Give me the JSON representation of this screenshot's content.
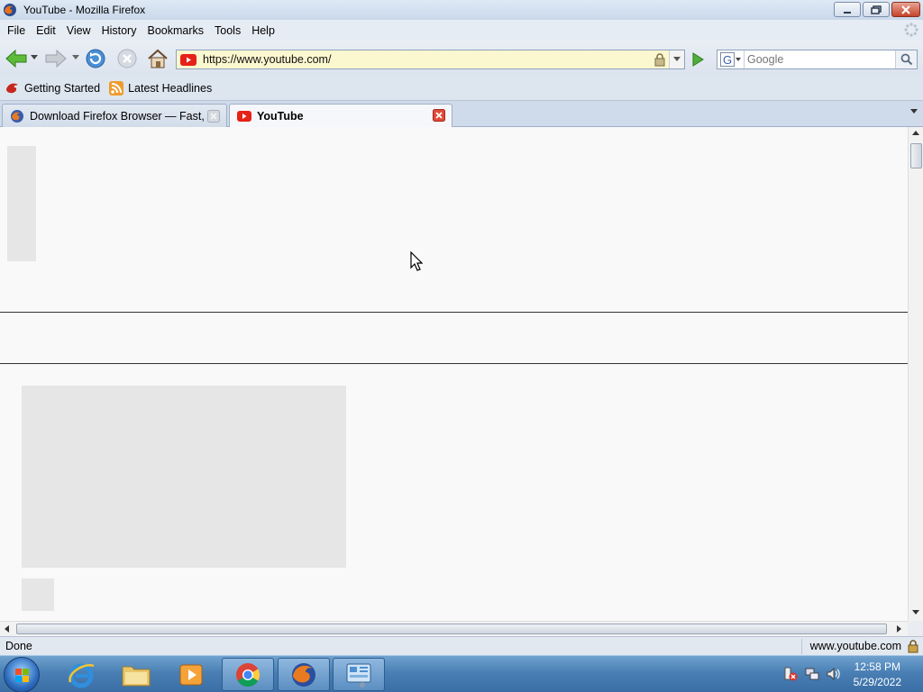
{
  "window": {
    "title": "YouTube - Mozilla Firefox"
  },
  "menubar": {
    "items": [
      "File",
      "Edit",
      "View",
      "History",
      "Bookmarks",
      "Tools",
      "Help"
    ]
  },
  "navbar": {
    "url": "https://www.youtube.com/",
    "search_placeholder": "Google",
    "icons": [
      "back-icon",
      "forward-icon",
      "reload-icon",
      "stop-icon",
      "home-icon"
    ]
  },
  "bookmarks": {
    "items": [
      {
        "label": "Getting Started",
        "icon": "getting-started-icon"
      },
      {
        "label": "Latest Headlines",
        "icon": "rss-icon"
      }
    ]
  },
  "tabs": [
    {
      "label": "Download Firefox Browser — Fast, ...",
      "active": false
    },
    {
      "label": "YouTube",
      "active": true
    }
  ],
  "status": {
    "text": "Done",
    "url": "www.youtube.com"
  },
  "taskbar": {
    "apps": [
      "internet-explorer",
      "windows-explorer",
      "media-player",
      "chrome",
      "firefox",
      "control-panel"
    ],
    "time": "12:58 PM",
    "date": "5/29/2022"
  },
  "colors": {
    "url_background": "#fbf7cf",
    "youtube_red": "#e62117",
    "taskbar_blue": "#4a7fb4"
  }
}
